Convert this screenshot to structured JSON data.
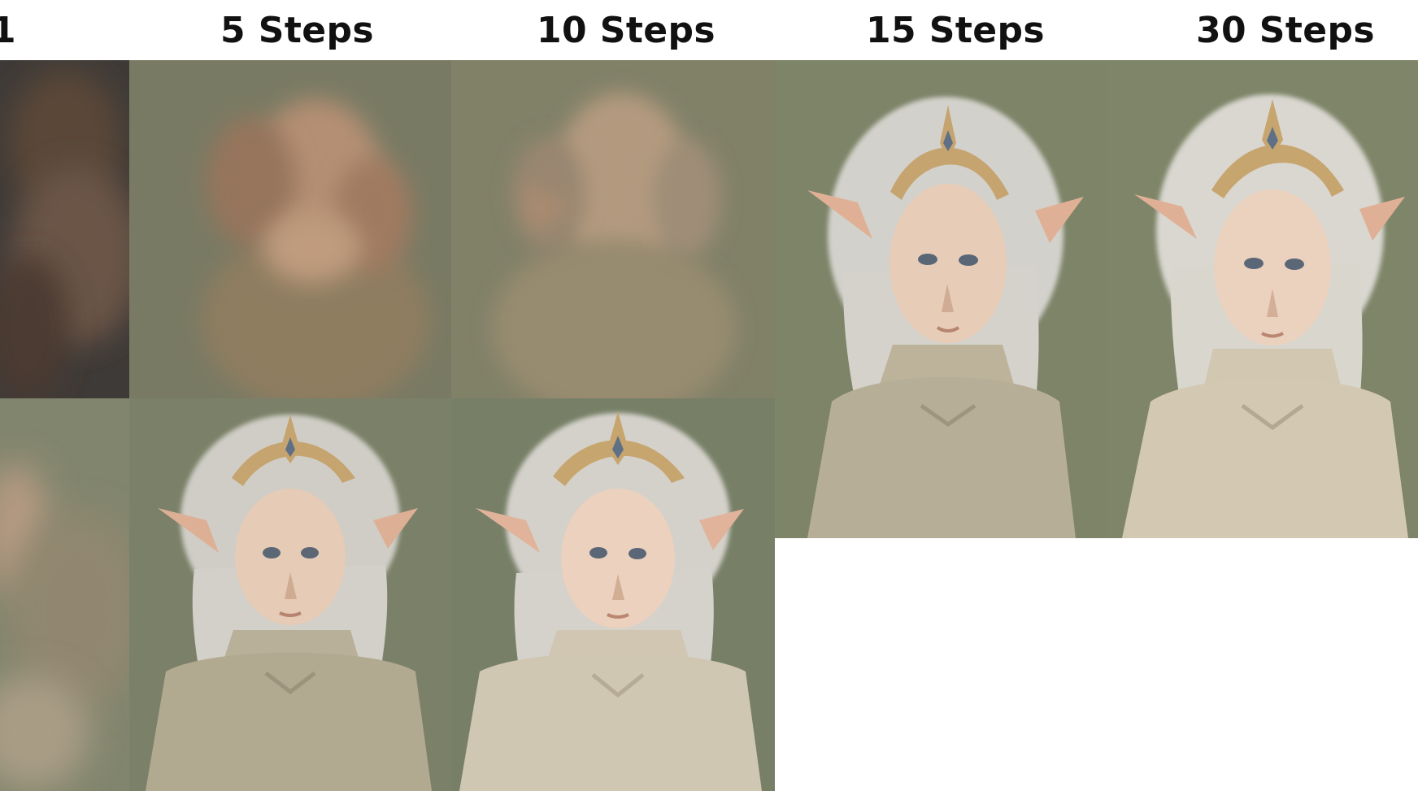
{
  "columns": {
    "partial_label": "1",
    "steps5": "5 Steps",
    "steps10": "10 Steps",
    "steps15": "15 Steps",
    "steps30": "30 Steps"
  },
  "colors": {
    "background": "#ffffff",
    "label_text": "#111111",
    "paint_bg_dark": "#3e3a37",
    "paint_bg_muted": "#7e8168",
    "paint_skin": "#dfc1a8",
    "paint_hair": "#d2d2cc",
    "paint_tiara": "#c6a46f",
    "paint_gem": "#5f7086",
    "paint_dress": "#b8ad94"
  },
  "icons": {
    "tile_graphic": "portrait-elf-illustration"
  }
}
